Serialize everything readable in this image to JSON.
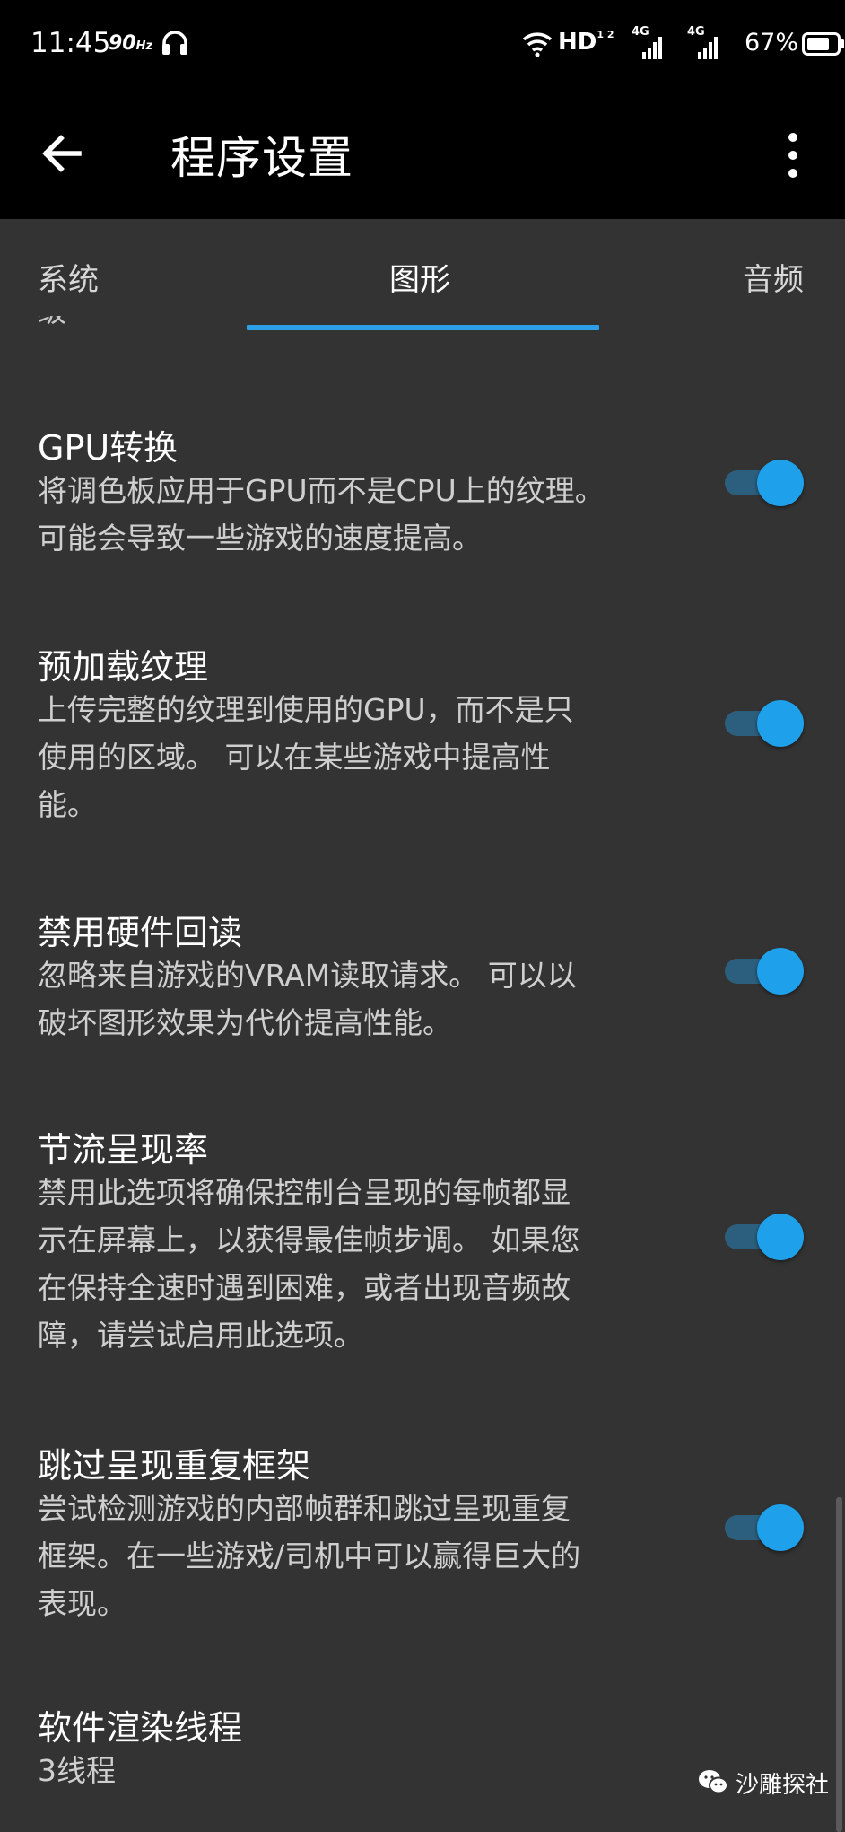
{
  "status_bar": {
    "time": "11:45",
    "refresh_rate": "90",
    "refresh_unit": "Hz",
    "headphone_icon": "headphone-icon",
    "wifi_icon": "wifi-icon",
    "hd_label": "HD",
    "hd_sub": "1 2",
    "network_1": "4G",
    "network_2": "4G",
    "battery_percent": "67%"
  },
  "app_bar": {
    "back_icon": "arrow-back-icon",
    "title": "程序设置",
    "more_icon": "more-vert-icon"
  },
  "tabs": [
    {
      "label": "系统",
      "active": false
    },
    {
      "label": "图形",
      "active": true
    },
    {
      "label": "音频",
      "active": false
    }
  ],
  "partial_item_text": "级",
  "settings": [
    {
      "title": "GPU转换",
      "description_lines": [
        "将调色板应用于GPU而不是CPU上的纹理。",
        "可能会导致一些游戏的速度提高。"
      ],
      "enabled": true
    },
    {
      "title": "预加载纹理",
      "description_lines": [
        "上传完整的纹理到使用的GPU，而不是只",
        "使用的区域。 可以在某些游戏中提高性",
        "能。"
      ],
      "enabled": true
    },
    {
      "title": "禁用硬件回读",
      "description_lines": [
        "忽略来自游戏的VRAM读取请求。 可以以",
        "破坏图形效果为代价提高性能。"
      ],
      "enabled": true
    },
    {
      "title": "节流呈现率",
      "description_lines": [
        "禁用此选项将确保控制台呈现的每帧都显",
        "示在屏幕上，以获得最佳帧步调。 如果您",
        "在保持全速时遇到困难，或者出现音频故",
        "障，请尝试启用此选项。"
      ],
      "enabled": true
    },
    {
      "title": "跳过呈现重复框架",
      "description_lines": [
        "尝试检测游戏的内部帧群和跳过呈现重复",
        "框架。在一些游戏/司机中可以赢得巨大的",
        "表现。"
      ],
      "enabled": true
    },
    {
      "title": "软件渲染线程",
      "value": "3线程"
    }
  ],
  "watermark": {
    "icon": "wechat-icon",
    "text": "沙雕探社"
  },
  "colors": {
    "background": "#333333",
    "bar_background": "#000000",
    "accent": "#1ea0ea",
    "switch_track": "#2c5f7e",
    "description_text": "#cfcfcf"
  }
}
